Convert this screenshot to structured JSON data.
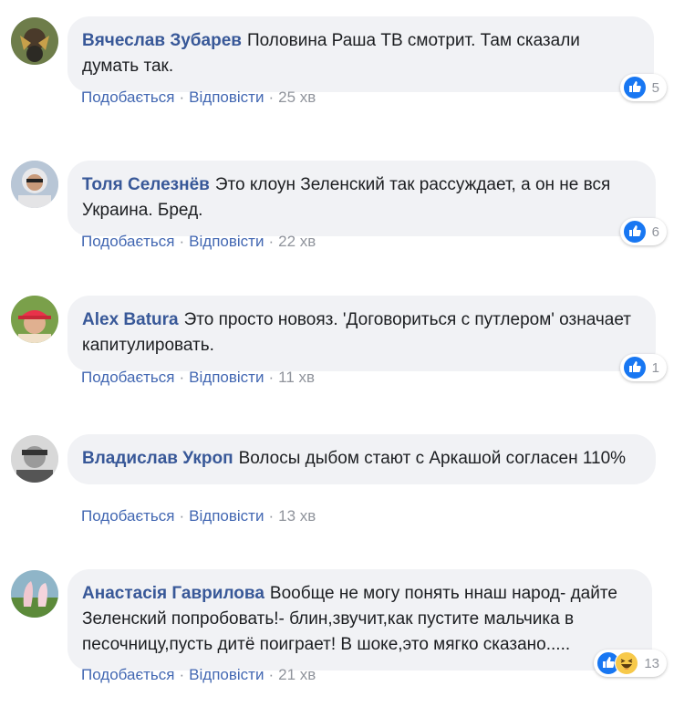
{
  "ui": {
    "like_label": "Подобається",
    "reply_label": "Відповісти",
    "separator": "·"
  },
  "comments": [
    {
      "author": "Вячеслав Зубарев",
      "text": "Половина Раша ТВ смотрит. Там сказали думать так.",
      "time": "25 хв",
      "reaction_count": "5",
      "reactions": [
        "like-icon"
      ]
    },
    {
      "author": "Толя Селезнёв",
      "text": "Это клоун Зеленский так рассуждает, а он не вся Украина. Бред.",
      "time": "22 хв",
      "reaction_count": "6",
      "reactions": [
        "like-icon"
      ]
    },
    {
      "author": "Alex Batura",
      "text": "Это просто новояз. 'Договориться с путлером' означает капитулировать.",
      "time": "11 хв",
      "reaction_count": "1",
      "reactions": [
        "like-icon"
      ]
    },
    {
      "author": "Владислав Укроп",
      "text": "Волосы дыбом стают с Аркашой согласен 110%",
      "time": "13 хв",
      "reaction_count": "",
      "reactions": []
    },
    {
      "author": "Анастасія Гаврилова",
      "text": "Вообще не могу понять ннаш народ- дайте Зеленский попробовать!- блин,звучит,как пустите мальчика в песочницу,пусть дитё поиграет! В шоке,это мягко сказано.....",
      "time": "21 хв",
      "reaction_count": "13",
      "reactions": [
        "like-icon",
        "haha-icon"
      ]
    }
  ],
  "colors": {
    "author": "#385898",
    "link": "#4267b2",
    "meta": "#90949c",
    "bubble": "#f1f2f5",
    "like": "#1877f2",
    "haha": "#f7c94a"
  }
}
